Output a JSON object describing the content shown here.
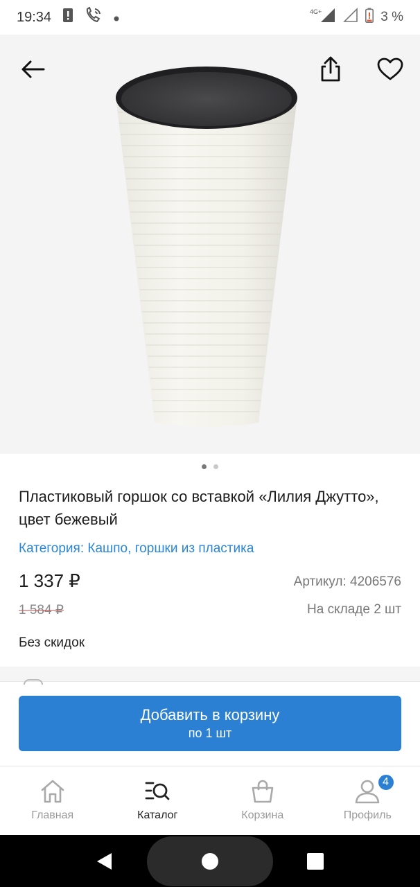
{
  "status_bar": {
    "time": "19:34",
    "network": "4G+",
    "battery": "3 %"
  },
  "gallery": {
    "slide_count": 2,
    "active_slide": 1
  },
  "product": {
    "title": "Пластиковый горшок со вставкой «Лилия Джутто», цвет бежевый",
    "category": "Категория: Кашпо, горшки из пластика",
    "price": "1 337 ₽",
    "old_price": "1 584 ₽",
    "sku": "Артикул: 4206576",
    "stock": "На складе 2 шт",
    "discount_note": "Без скидок"
  },
  "cart_button": {
    "label": "Добавить в корзину",
    "sub_label": "по 1 шт"
  },
  "bottom_nav": {
    "items": [
      {
        "label": "Главная",
        "icon": "home-icon"
      },
      {
        "label": "Каталог",
        "icon": "catalog-search-icon",
        "active": true
      },
      {
        "label": "Корзина",
        "icon": "shopping-bag-icon"
      },
      {
        "label": "Профиль",
        "icon": "profile-icon",
        "badge": "4"
      }
    ]
  },
  "colors": {
    "accent": "#2c80d3",
    "link": "#2a86d6",
    "old_price_strike": "#d9534f"
  }
}
